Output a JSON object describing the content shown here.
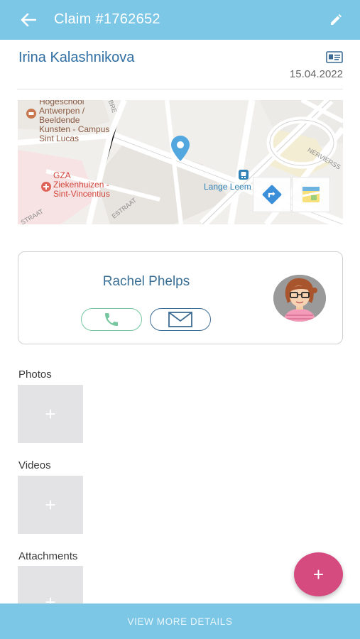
{
  "header": {
    "title": "Claim #1762652",
    "back_icon": "arrow-left-icon",
    "edit_icon": "pencil-icon"
  },
  "claim": {
    "claimant_name": "Irina Kalashnikova",
    "date": "15.04.2022",
    "id_icon": "id-card-icon"
  },
  "map": {
    "labels": {
      "school": "Hogeschool\nAntwerpen /\nBeeldende\nKunsten - Campus\nSint Lucas",
      "hospital": "GZA\nZiekenhuizen -\nSint-Vincentius",
      "station": "Lange Leem",
      "street_bottom": "ESTRAAT",
      "street_left": "STRAAT",
      "street_top": "BRE",
      "street_right": "NERVIERSS"
    },
    "icons": [
      "location-pin-icon",
      "directions-icon",
      "open-maps-icon"
    ]
  },
  "contact": {
    "name": "Rachel Phelps",
    "call_icon": "phone-icon",
    "mail_icon": "envelope-icon",
    "avatar": "avatar"
  },
  "sections": {
    "photos": "Photos",
    "videos": "Videos",
    "attachments": "Attachments",
    "add_glyph": "+"
  },
  "fab": {
    "label": "+"
  },
  "footer": {
    "label": "VIEW MORE DETAILS"
  },
  "colors": {
    "header": "#7cc6e6",
    "name": "#2f6fa4",
    "call_border": "#76c6a0",
    "mail_border": "#3d6c94",
    "fab": "#d54b80",
    "tile": "#e3e3e6"
  }
}
